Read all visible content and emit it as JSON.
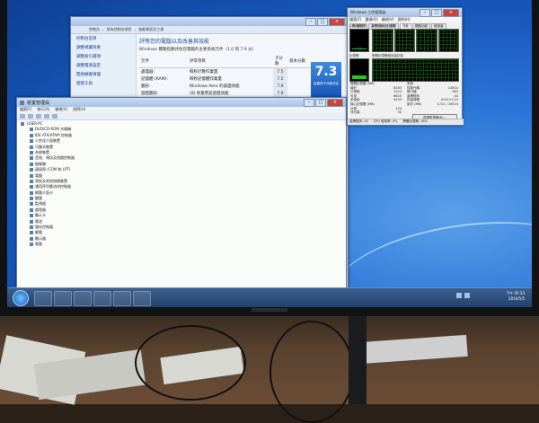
{
  "performance_window": {
    "breadcrumb": [
      "控制台",
      "所有控制台項目",
      "效能資訊及工具"
    ],
    "left_nav": [
      "控制台首頁",
      "調整視覺效果",
      "調整索引選項",
      "調整電源設定",
      "開啟磁碟清理",
      "進階工具"
    ],
    "title": "評等您的電腦以及改善其效能",
    "description": "Windows 體驗指數評估您電腦的主要系統元件（1.0 到 7.9 分）",
    "table_headers": [
      "元件",
      "評等項目",
      "子分數",
      "基本分數"
    ],
    "rows": [
      {
        "component": "處理器:",
        "description": "每秒計算作業量",
        "score": "7.5"
      },
      {
        "component": "記憶體 (RAM):",
        "description": "每秒記憶體作業量",
        "score": "7.5"
      },
      {
        "component": "圖形:",
        "description": "Windows Aero 的桌面效能",
        "score": "7.9"
      },
      {
        "component": "遊戲圖形:",
        "description": "3D 商業用途遊戲效能",
        "score": "7.9"
      },
      {
        "component": "主要硬碟:",
        "description": "磁碟資料傳輸速率",
        "score": "7.3"
      }
    ],
    "base_score": "7.3",
    "base_score_caption": "由最低子分數決定"
  },
  "device_manager": {
    "title": "裝置管理員",
    "menu": [
      "檔案(F)",
      "執行(A)",
      "檢視(V)",
      "說明(H)"
    ],
    "tree_root": "USER-PC",
    "tree_items": [
      "DVD/CD-ROM 光碟機",
      "IDE ATA/ATAPI 控制器",
      "人性化介面裝置",
      "可攜式裝置",
      "系統裝置",
      "音效、視訊及遊戲控制器",
      "磁碟機",
      "連接埠 (COM 和 LPT)",
      "電腦",
      "滑鼠及其他指標裝置",
      "通用序列匯流排控制器",
      "網路介面卡",
      "鍵盤",
      "監視器",
      "處理器",
      "顯示卡",
      "電池",
      "儲存控制器",
      "鍵盤",
      "顯示器",
      "電腦"
    ]
  },
  "task_manager": {
    "title": "Windows 工作管理員",
    "menu": [
      "檔案(F)",
      "選項(O)",
      "檢視(V)",
      "說明(H)"
    ],
    "tabs": [
      "應用程式",
      "處理程序",
      "服務",
      "效能",
      "網路功能",
      "使用者"
    ],
    "active_tab_index": 3,
    "cpu_label": "CPU 使用率",
    "cpu_history_label": "CPU 使用率記錄",
    "cpu_percent": "0 %",
    "cpu_usage": 0.05,
    "mem_label": "記憶體",
    "mem_history_label": "實體記憶體使用量記錄",
    "mem_value": "1.49 GB",
    "mem_usage": 0.2,
    "stats_left": [
      {
        "label": "實體記憶體 (MB)",
        "value": ""
      },
      {
        "label": "總計",
        "value": "8163"
      },
      {
        "label": "已快取",
        "value": "1223"
      },
      {
        "label": "可用",
        "value": "6625"
      },
      {
        "label": "未使用",
        "value": "5433"
      },
      {
        "label": "核心記憶體 (MB)",
        "value": ""
      },
      {
        "label": "分頁",
        "value": "134"
      },
      {
        "label": "非分頁",
        "value": "30"
      }
    ],
    "stats_right": [
      {
        "label": "系統",
        "value": ""
      },
      {
        "label": "控制代碼",
        "value": "14810"
      },
      {
        "label": "執行緒",
        "value": "583"
      },
      {
        "label": "處理程序",
        "value": "44"
      },
      {
        "label": "存留時間",
        "value": "0:00:11:23"
      },
      {
        "label": "認可 (MB)",
        "value": "1722 / 16324"
      }
    ],
    "resource_button": "資源監視器(R)...",
    "status": [
      "處理程序: 44",
      "CPU 使用率: 0%",
      "實體記憶體: 18%"
    ]
  },
  "taskbar": {
    "apps": [
      "ie-icon",
      "folder-icon",
      "media-player-icon",
      "device-manager-icon",
      "task-manager-icon",
      "performance-icon"
    ],
    "time": "下午 05:33",
    "date": "2010/5/5"
  },
  "colors": {
    "wallpaper": "#2b76d8",
    "taskbar": "#22406a",
    "score_badge": "#1f64c4",
    "graph_green": "#1dcc1d"
  }
}
